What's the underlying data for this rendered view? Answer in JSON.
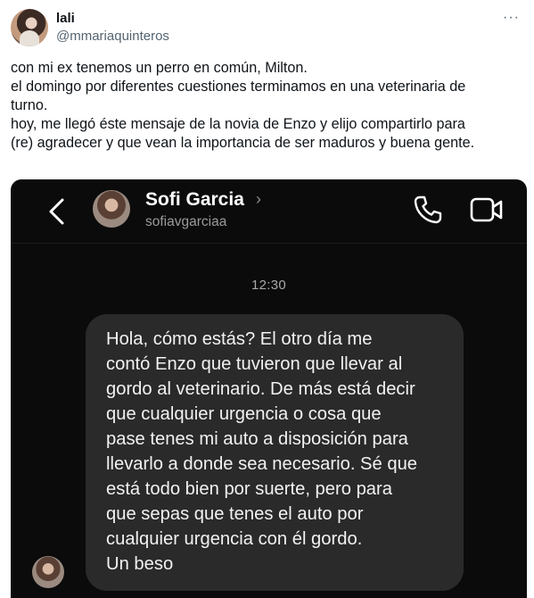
{
  "tweet": {
    "author": {
      "display_name": "lali",
      "handle": "@mmariaquinteros"
    },
    "more_icon": "more-horizontal-icon",
    "text_lines": [
      "con mi ex tenemos un perro en común, Milton.",
      "el domingo por diferentes cuestiones terminamos en una veterinaria de",
      "turno.",
      "hoy, me llegó éste mensaje de la novia de Enzo y elijo compartirlo para",
      "(re) agradecer y que vean la importancia de ser maduros y buena gente."
    ]
  },
  "dm": {
    "contact": {
      "name": "Sofi Garcia",
      "username": "sofiavgarciaa",
      "chevron": "›"
    },
    "icons": {
      "back": "back-arrow-icon",
      "phone": "phone-icon",
      "video": "video-camera-icon"
    },
    "timestamp": "12:30",
    "message_lines": [
      "Hola, cómo estás? El otro día me",
      "contó Enzo que tuvieron que llevar al",
      "gordo al veterinario. De más está decir",
      "que cualquier urgencia o cosa que",
      "pase tenes mi auto a disposición para",
      "llevarlo a donde sea necesario. Sé que",
      "está todo bien por suerte, pero para",
      "que sepas que tenes el auto por",
      "cualquier urgencia con él gordo.",
      "Un beso"
    ],
    "colors": {
      "background": "#0b0b0b",
      "bubble": "#2a2a2a",
      "text": "#f2f2f2"
    }
  }
}
